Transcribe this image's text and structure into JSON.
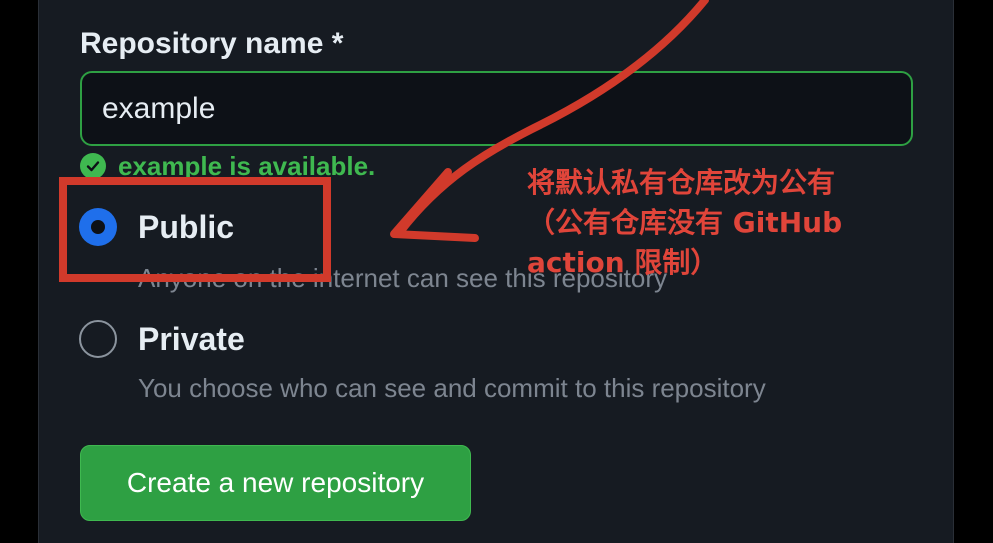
{
  "form": {
    "repo_name_label": "Repository name *",
    "repo_name_value": "example",
    "availability_message": "example is available.",
    "visibility_options": [
      {
        "label": "Public",
        "description": "Anyone on the internet can see this repository",
        "selected": true
      },
      {
        "label": "Private",
        "description": "You choose who can see and commit to this repository",
        "selected": false
      }
    ],
    "create_button_label": "Create a new repository"
  },
  "annotation": {
    "lines": [
      "将默认私有仓库改为公有",
      "（公有仓库没有 GitHub",
      "action 限制）"
    ],
    "color": "#e0453a"
  },
  "icons": {
    "availability": "check-circle-icon"
  },
  "colors": {
    "panel_background": "#161b22",
    "accent_green": "#2ea043",
    "success_text": "#3fb950",
    "radio_selected": "#1f6feb",
    "annotation_red": "#d13a2b"
  }
}
